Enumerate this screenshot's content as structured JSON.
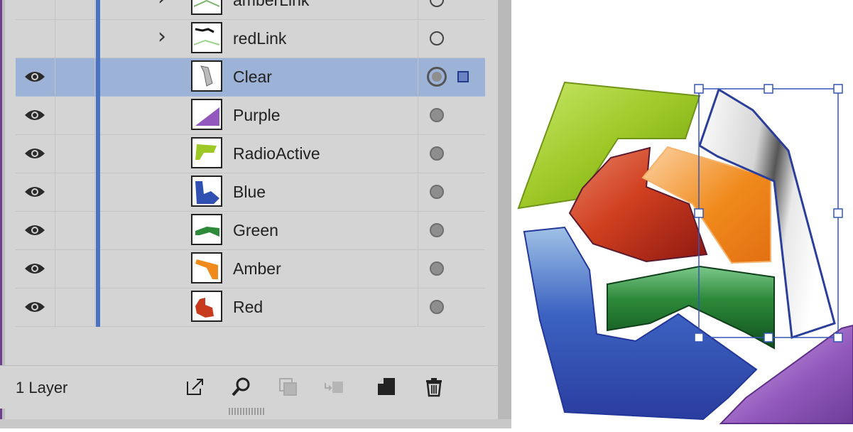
{
  "layers_panel": {
    "rows": [
      {
        "name": "amberLink",
        "visible": false,
        "expandable": true,
        "target": "open",
        "selected": false,
        "thumb": "amberLink"
      },
      {
        "name": "redLink",
        "visible": false,
        "expandable": true,
        "target": "open",
        "selected": false,
        "thumb": "redLink"
      },
      {
        "name": "Clear",
        "visible": true,
        "expandable": false,
        "target": "active",
        "selected": true,
        "thumb": "clear"
      },
      {
        "name": "Purple",
        "visible": true,
        "expandable": false,
        "target": "filled",
        "selected": false,
        "thumb": "purple"
      },
      {
        "name": "RadioActive",
        "visible": true,
        "expandable": false,
        "target": "filled",
        "selected": false,
        "thumb": "radioactive"
      },
      {
        "name": "Blue",
        "visible": true,
        "expandable": false,
        "target": "filled",
        "selected": false,
        "thumb": "blue"
      },
      {
        "name": "Green",
        "visible": true,
        "expandable": false,
        "target": "filled",
        "selected": false,
        "thumb": "green"
      },
      {
        "name": "Amber",
        "visible": true,
        "expandable": false,
        "target": "filled",
        "selected": false,
        "thumb": "amber"
      },
      {
        "name": "Red",
        "visible": true,
        "expandable": false,
        "target": "filled",
        "selected": false,
        "thumb": "red"
      }
    ],
    "layer_count": "1 Layer",
    "tools": [
      {
        "name": "export-icon"
      },
      {
        "name": "search-icon"
      },
      {
        "name": "make-clipping-mask-icon"
      },
      {
        "name": "create-sublayer-icon"
      },
      {
        "name": "create-new-layer-icon"
      },
      {
        "name": "trash-icon"
      }
    ],
    "colors": {
      "panel_bg": "#d4d4d4",
      "selected_row": "#9cb2d6",
      "layer_color_bar": "#4a72c2"
    }
  },
  "artwork": {
    "shapes": [
      "RadioActive",
      "Red",
      "Amber",
      "Clear",
      "Green",
      "Blue",
      "Purple"
    ],
    "colors": {
      "radioactive": "#9dc826",
      "red": "#c83a1e",
      "amber": "#f08a1c",
      "green": "#2d8a3a",
      "blue": "#2f4fae",
      "purple": "#8e57b8",
      "selection": "#3555b5"
    }
  }
}
